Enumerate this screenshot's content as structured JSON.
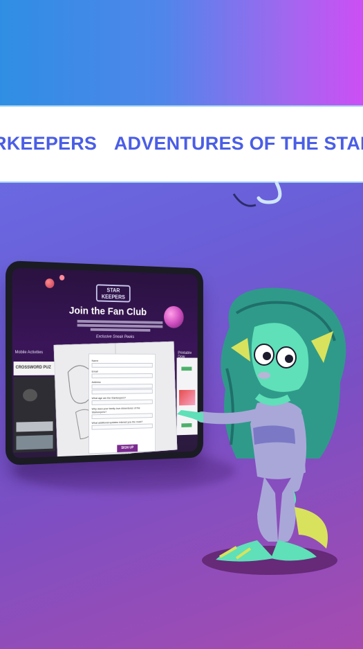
{
  "banner": {
    "marquee_items": [
      "RKEEPERS",
      "ADVENTURES OF THE STAR"
    ]
  },
  "tablet": {
    "logo_text": "STAR KEEPERS",
    "title": "Join the Fan Club",
    "sneak_peek": "Exclusive Sneak Peeks",
    "left_label": "Mobile Activities",
    "crossword": "CROSSWORD PUZ",
    "right_label": "Printable Dow",
    "signup_button": "SIGN UP NOW",
    "form": {
      "fields": [
        "Name",
        "Email",
        "Address"
      ],
      "questions": [
        "What age are the Starkeepers?",
        "Why does your family love Adventures of the Starkeepers?",
        "What additional updates interest you the most?"
      ]
    }
  },
  "colors": {
    "banner_text": "#4a5ee6",
    "background_top": "#3a8fe0",
    "background_bottom": "#a64bb0",
    "character_skin": "#5fe0b8",
    "character_hair": "#2f9a8a"
  }
}
